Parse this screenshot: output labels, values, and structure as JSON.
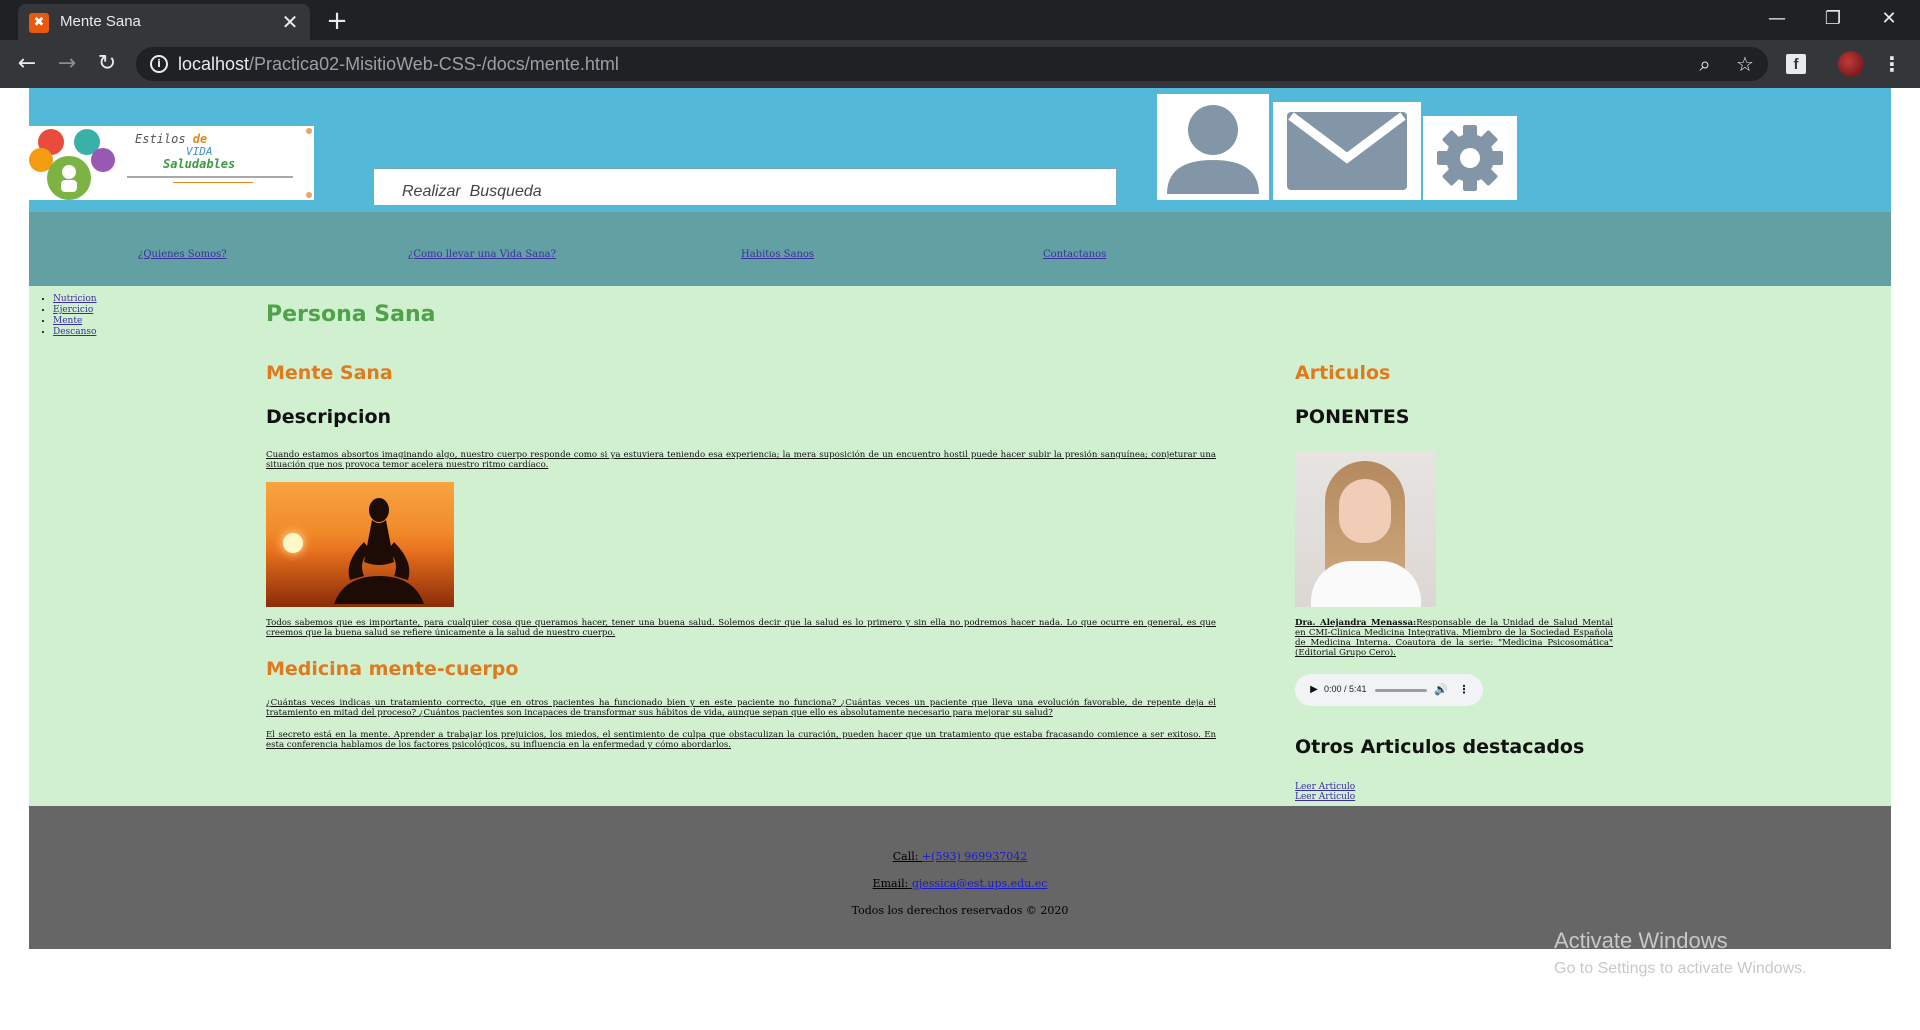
{
  "browser": {
    "tab_title": "Mente Sana",
    "tab_close": "✕",
    "new_tab": "+",
    "url_host": "localhost",
    "url_path": "/Practica02-MisitioWeb-CSS-/docs/mente.html"
  },
  "header": {
    "logo": {
      "line1_a": "Estilos ",
      "line1_b": "de",
      "line2": "VIDA",
      "line3": "Saludables"
    },
    "search_placeholder": "Realizar  Busqueda"
  },
  "nav": {
    "links": [
      "¿Quienes Somos?",
      "¿Como llevar una Vida Sana?",
      "Habitos Sanos",
      "Contactanos"
    ]
  },
  "sidebar": {
    "items": [
      "Nutricion",
      "Ejercicio",
      "Mente",
      "Descanso"
    ]
  },
  "main": {
    "page_title": "Persona Sana",
    "section_title": "Mente Sana",
    "description_title": "Descripcion",
    "paragraph1": "Cuando estamos absortos imaginando algo, nuestro cuerpo responde como si ya estuviera teniendo esa experiencia; la mera suposición de un encuentro hostil puede hacer subir la presión sanguínea; conjeturar una situación que nos provoca temor acelera nuestro ritmo cardíaco.",
    "paragraph2": "Todos sabemos que es importante, para cualquier cosa que queramos hacer, tener una buena salud. Solemos decir que la salud es lo primero y sin ella no podremos hacer nada. Lo que ocurre en general, es que creemos que la buena salud se refiere únicamente a la salud de nuestro cuerpo.",
    "medicina_title": "Medicina mente-cuerpo",
    "paragraph3": "¿Cuántas veces indicas un tratamiento correcto, que en otros pacientes ha funcionado bien y en este paciente no funciona? ¿Cuántas veces un paciente que lleva una evolución favorable, de repente deja el tratamiento en mitad del proceso? ¿Cuántos pacientes son incapaces de transformar sus hábitos de vida, aunque sepan que ello es absolutamente necesario para mejorar su salud?",
    "paragraph4": "El secreto está en la mente. Aprender a trabajar los prejuicios, los miedos, el sentimiento de culpa que obstaculizan la curación, pueden hacer que un tratamiento que estaba fracasando comience a ser exitoso. En esta conferencia hablamos de los factores psicológicos, su influencia en la enfermedad y cómo abordarlos."
  },
  "aside": {
    "title": "Articulos",
    "ponentes_title": "PONENTES",
    "ponente_name": "Dra. Alejandra Menassa:",
    "ponente_bio": "Responsable de la Unidad de Salud Mental en CMI-Clinica Medicina Integrativa. Miembro de la Sociedad Española de Medicina Interna. Coautora de la serie: \"Medicina Psicosomática\" (Editorial Grupo Cero).",
    "audio_time": "0:00 / 5:41",
    "otros_title": "Otros Articulos destacados",
    "read_links": [
      "Leer Articulo",
      "Leer Articulo"
    ]
  },
  "footer": {
    "call_label": "Call: ",
    "call_value": "+(593) 969937042",
    "email_label": "Email: ",
    "email_value": "gjessica@est.ups.edu.ec",
    "rights": "Todos los derechos reservados © 2020"
  },
  "os_overlay": {
    "activate_title": "Activate Windows",
    "activate_sub": "Go to Settings to activate Windows."
  },
  "colors": {
    "header_bg": "#54b8d8",
    "nav_bg": "#62a0a4",
    "main_bg": "#d0f0d0",
    "footer_bg": "#666666",
    "title_green": "#4fa24a",
    "title_orange": "#e07a1e"
  }
}
